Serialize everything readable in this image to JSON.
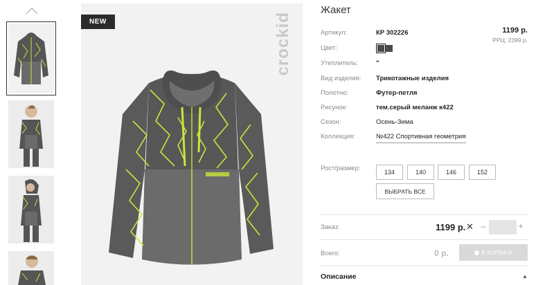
{
  "product": {
    "title": "Жакет",
    "badge": "NEW",
    "brand_logo": "crockid"
  },
  "price": {
    "current": "1199 р.",
    "rrp": "РРЦ: 2399 р."
  },
  "details": [
    {
      "label": "Артикул:",
      "value": "КР 302226"
    },
    {
      "label": "Цвет:",
      "value": ""
    },
    {
      "label": "Утеплитель:",
      "value": "\""
    },
    {
      "label": "Вид изделия:",
      "value": "Трикотажные изделия"
    },
    {
      "label": "Полотно:",
      "value": "Футер-петля"
    },
    {
      "label": "Рисунок:",
      "value": "тем.серый меланж к422"
    },
    {
      "label": "Сезон:",
      "value": "Осень-Зима"
    },
    {
      "label": "Коллекция:",
      "value": "№422 Спортивная геометрия"
    }
  ],
  "colors": [
    {
      "name": "dark-gray",
      "hex": "#4a4a4a",
      "selected": true
    },
    {
      "name": "dark-gray-2",
      "hex": "#4a4a4a",
      "selected": false
    }
  ],
  "sizes": {
    "label": "Рост/размер:",
    "options": [
      "134",
      "140",
      "146",
      "152"
    ],
    "select_all": "ВЫБРАТЬ ВСЕ"
  },
  "order": {
    "label": "Заказ:",
    "price": "1199 р.",
    "remove_icon": "close-icon",
    "minus": "–",
    "plus": "+",
    "quantity": ""
  },
  "total": {
    "label": "Всего:",
    "value": "0 р.",
    "cart_button": "В КОРЗИНУ"
  },
  "description": {
    "title": "Описание",
    "arrow": "▲"
  },
  "thumbnails": [
    {
      "name": "thumb-jacket-front",
      "selected": true
    },
    {
      "name": "thumb-model-front",
      "selected": false
    },
    {
      "name": "thumb-model-side",
      "selected": false
    },
    {
      "name": "thumb-model-hood",
      "selected": false
    }
  ],
  "accent_colors": {
    "lime": "#c8e63a",
    "jacket_gray": "#555555"
  }
}
